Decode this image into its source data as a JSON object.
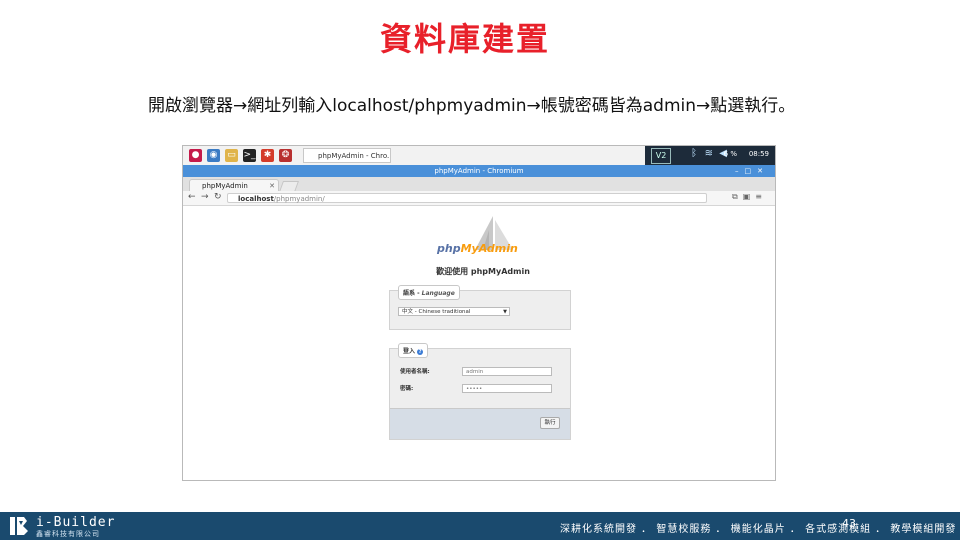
{
  "slide": {
    "title": "資料庫建置",
    "instruction": "開啟瀏覽器→網址列輸入localhost/phpmyadmin→帳號密碼皆為admin→點選執行。"
  },
  "screenshot": {
    "taskbar": {
      "task_label": "phpMyAdmin - Chro...",
      "v2_label": "V2",
      "cpu": "6 %",
      "clock": "08:59"
    },
    "window": {
      "title": "phpMyAdmin - Chromium",
      "tab_label": "phpMyAdmin",
      "url_host": "localhost",
      "url_path": "/phpmyadmin/"
    },
    "page": {
      "logo_php": "php",
      "logo_myadmin": "MyAdmin",
      "welcome": "歡迎使用 phpMyAdmin",
      "language_legend": "語系 - ",
      "language_legend_en": "Language",
      "language_selected": "中文 - Chinese traditional",
      "login_legend": "登入",
      "username_label": "使用者名稱:",
      "username_value": "admin",
      "password_label": "密碼:",
      "password_value": "•••••",
      "go_button": "執行"
    }
  },
  "footer": {
    "brand": "i-Builder",
    "brand_sub": "鑫睿科技有限公司",
    "slogan": "深耕化系統開發 ． 智慧校服務 ． 機能化晶片 ． 各式感測模組 ． 教學模組開發",
    "page_number": "43"
  },
  "colors": {
    "title_red": "#e8202a",
    "footer_blue": "#1a4a6e",
    "chromium_blue": "#4a90d9"
  }
}
